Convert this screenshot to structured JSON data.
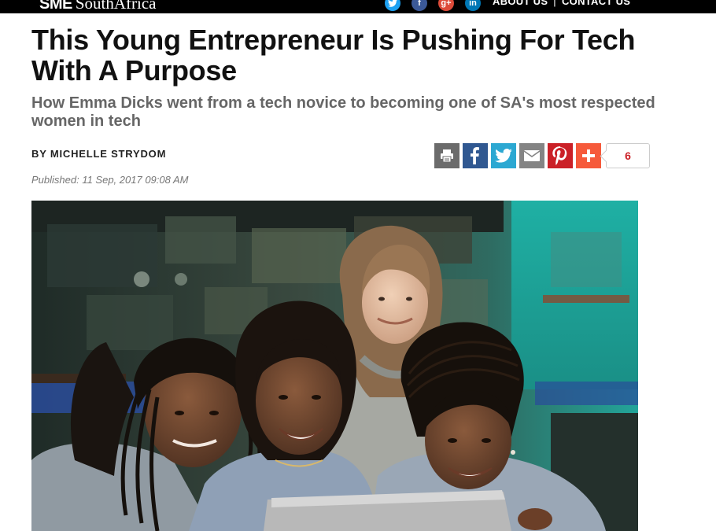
{
  "site": {
    "logo_bold": "SME",
    "logo_region": "SouthAfrica",
    "nav": {
      "about": "ABOUT US",
      "separator": "|",
      "contact": "CONTACT US"
    },
    "social_icons": [
      "twitter-icon",
      "facebook-icon",
      "google-plus-icon",
      "linkedin-icon"
    ]
  },
  "article": {
    "title": "This Young Entrepreneur Is Pushing For Tech With A Purpose",
    "subtitle": "How Emma Dicks went from a tech novice to becoming one of SA's most respected women in tech",
    "byline": "BY MICHELLE STRYDOM",
    "published": "Published: 11 Sep, 2017 09:08 AM"
  },
  "share_bar": {
    "buttons": [
      "print-icon",
      "facebook-icon",
      "twitter-icon",
      "email-icon",
      "pinterest-icon",
      "plus-icon"
    ],
    "count": "6"
  },
  "colors": {
    "topbar": "#000000",
    "headline": "#111111",
    "subhead": "#666666",
    "pinterest": "#cb2027",
    "plus": "#f65a3b"
  },
  "hero_image": {
    "description_icon": "photo-four-women-looking-at-laptop"
  }
}
